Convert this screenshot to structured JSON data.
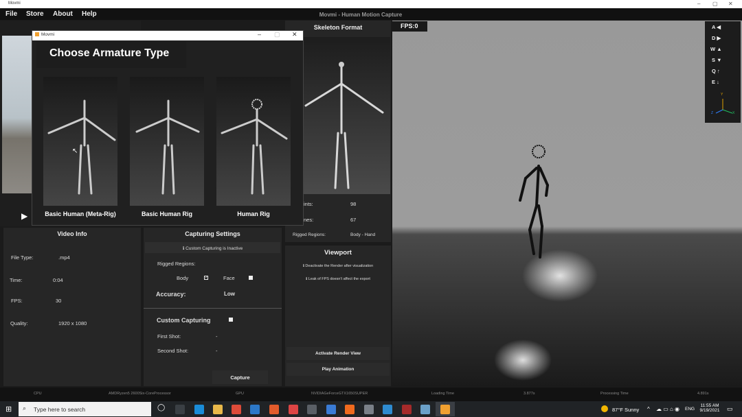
{
  "window": {
    "title": "Movmi",
    "app_title": "Movmi - Human Motion Capture"
  },
  "menu": {
    "file": "File",
    "store": "Store",
    "about": "About",
    "help": "Help"
  },
  "dialog": {
    "title": "Movmi",
    "heading": "Choose Armature Type",
    "cards": [
      "Basic Human (Meta-Rig)",
      "Basic Human Rig",
      "Human Rig"
    ]
  },
  "skeleton": {
    "header": "Skeleton Format",
    "joints_label": "ints:",
    "joints_value": "98",
    "bones_label": "nes:",
    "bones_value": "67",
    "rigged_label": "Rigged Regions:",
    "rigged_value": "Body - Hand"
  },
  "video_info": {
    "header": "Video Info",
    "file_type_label": "File Type:",
    "file_type": ".mp4",
    "time_label": "Time:",
    "time": "0:04",
    "fps_label": "FPS:",
    "fps": "30",
    "quality_label": "Quality:",
    "quality": "1920 x 1080"
  },
  "capture": {
    "header": "Capturing Settings",
    "notice": "ℹ Custom Capturing is Inactive",
    "rigged_label": "Rigged Regions:",
    "body": "Body",
    "face": "Face",
    "accuracy_label": "Accuracy:",
    "accuracy": "Low",
    "custom_label": "Custom Capturing",
    "first_label": "First Shot:",
    "first": "-",
    "second_label": "Second Shot:",
    "second": "-",
    "capture_btn": "Capture"
  },
  "viewport_panel": {
    "header": "Viewport",
    "note1": "ℹ Deactivate the Render after visualization",
    "note2": "ℹ Leak of FPS doesn't affect the export",
    "activate": "Activate Render View",
    "play": "Play Animation"
  },
  "viewport": {
    "fps": "FPS:0",
    "nav": [
      {
        "k": "A",
        "a": "◀"
      },
      {
        "k": "D",
        "a": "▶"
      },
      {
        "k": "W",
        "a": "▲"
      },
      {
        "k": "S",
        "a": "▼"
      },
      {
        "k": "Q",
        "a": "↑"
      },
      {
        "k": "E",
        "a": "↓"
      }
    ],
    "axes": {
      "y": "Y",
      "z": "Z",
      "x": "X"
    }
  },
  "status": {
    "cpu_label": "CPU",
    "cpu": "AMDRyzen5 2600Six-CoreProcessor",
    "gpu_label": "GPU",
    "gpu": "NVIDIAGeForceGTX1650SUPER",
    "loading_label": "Loading Time",
    "loading": "3.877s",
    "processing_label": "Processing Time",
    "processing": "4.891s"
  },
  "taskbar": {
    "search": "Type here to search",
    "weather": "87°F  Sunny",
    "lang": "ENG",
    "time": "11:55 AM",
    "date": "9/19/2021"
  },
  "colors": {
    "accent": "#f0a030",
    "bg": "#1b1b1b",
    "panel": "#262626"
  }
}
